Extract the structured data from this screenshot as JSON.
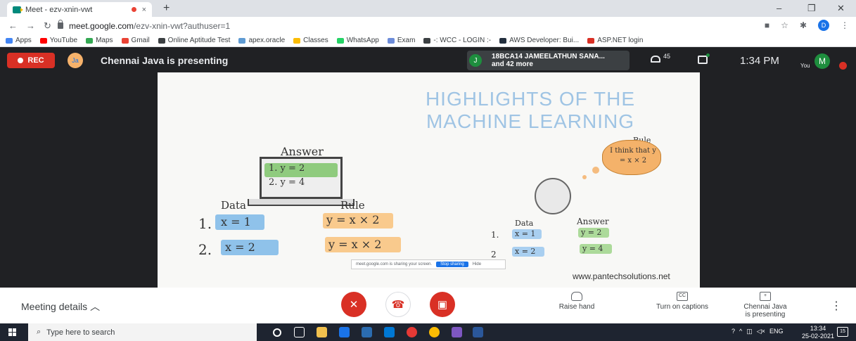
{
  "browser": {
    "tab_title": "Meet - ezv-xnin-vwt",
    "tab_close": "×",
    "new_tab": "+",
    "url_host": "meet.google.com",
    "url_path": "/ezv-xnin-vwt?authuser=1",
    "profile_initial": "D",
    "window_min": "–",
    "window_max": "❐",
    "window_close": "✕"
  },
  "bookmarks": [
    {
      "label": "Apps",
      "color": "#4285f4"
    },
    {
      "label": "YouTube",
      "color": "#ff0000"
    },
    {
      "label": "Maps",
      "color": "#34a853"
    },
    {
      "label": "Gmail",
      "color": "#ea4335"
    },
    {
      "label": "Online Aptitude Test",
      "color": "#3c4043"
    },
    {
      "label": "apex.oracle",
      "color": "#5f9bd3"
    },
    {
      "label": "Classes",
      "color": "#fbbc04"
    },
    {
      "label": "WhatsApp",
      "color": "#25d366"
    },
    {
      "label": "Exam",
      "color": "#6d8cd9"
    },
    {
      "label": "-: WCC - LOGIN :-",
      "color": "#3c4043"
    },
    {
      "label": "AWS Developer: Bui...",
      "color": "#232f3e"
    },
    {
      "label": "ASP.NET login",
      "color": "#d93025"
    }
  ],
  "meet": {
    "rec_label": "REC",
    "presenter_avatar_text": "Ja",
    "presenting_text": "Chennai Java is presenting",
    "participant_initial": "J",
    "participant_line1": "18BCA14 JAMEELATHUN SANA...",
    "participant_line2": "and 42 more",
    "people_count": "45",
    "clock": "1:34 PM",
    "you_label": "You",
    "you_initial": "M"
  },
  "slide": {
    "title_line1": "HIGHLIGHTS OF THE",
    "title_line2": "MACHINE LEARNING",
    "answer_label": "Answer",
    "answer_1": "1. y = 2",
    "answer_2": "2. y = 4",
    "data_label": "Data",
    "rule_label": "Rule",
    "row1_num": "1.",
    "row1_data": "x = 1",
    "row1_rule": "y = x × 2",
    "row2_num": "2.",
    "row2_data": "x = 2",
    "row2_rule": "y = x × 2",
    "robot_rule_label": "Rule",
    "robot_thought": "I think that y = x × 2",
    "robot_data_label": "Data",
    "robot_answer_label": "Answer",
    "robot_row1_num": "1.",
    "robot_row1_data": "x = 1",
    "robot_row1_answer": "y = 2",
    "robot_row2_num": "2",
    "robot_row2_data": "x = 2",
    "robot_row2_answer": "y = 4",
    "share_notice_text": "meet.google.com is sharing your screen.",
    "stop_sharing": "Stop sharing",
    "hide": "Hide",
    "website": "www.pantechsolutions.net"
  },
  "bottom": {
    "meeting_details": "Meeting details",
    "raise_hand": "Raise hand",
    "captions": "Turn on captions",
    "presenting_line1": "Chennai Java",
    "presenting_line2": "is presenting"
  },
  "taskbar": {
    "search_placeholder": "Type here to search",
    "lang": "ENG",
    "time": "13:34",
    "date": "25-02-2021",
    "notifications": "15"
  }
}
